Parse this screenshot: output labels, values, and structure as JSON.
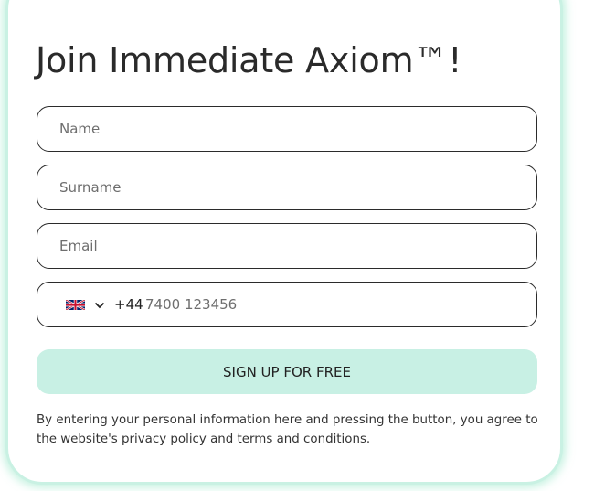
{
  "form": {
    "title": "Join Immediate Axiom™!",
    "name_placeholder": "Name",
    "surname_placeholder": "Surname",
    "email_placeholder": "Email",
    "phone": {
      "country_flag": "uk-flag-icon",
      "dial_code": "+44",
      "placeholder": "7400 123456"
    },
    "submit_label": "SIGN UP FOR FREE",
    "disclaimer": "By entering your personal information here and pressing the button, you agree to the website's privacy policy and terms and conditions."
  },
  "colors": {
    "button_bg": "#c8f0e4",
    "card_glow": "#c9f1e3",
    "border": "#2b2b2b"
  }
}
